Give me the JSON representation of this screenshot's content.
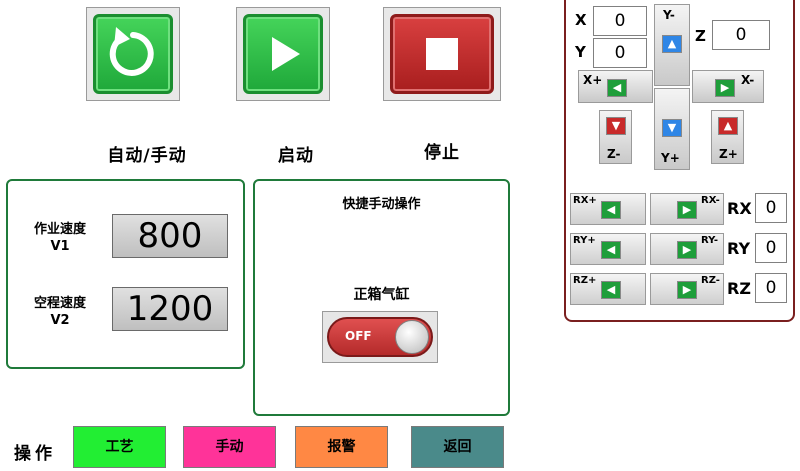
{
  "actions": {
    "auto_manual_label": "自动/手动",
    "start_label": "启动",
    "stop_label": "停止"
  },
  "speed_panel": {
    "work_speed_line1": "作业速度",
    "work_speed_line2": "V1",
    "work_speed_value": "800",
    "idle_speed_line1": "空程速度",
    "idle_speed_line2": "V2",
    "idle_speed_value": "1200"
  },
  "quick_panel": {
    "title": "快捷手动操作",
    "cylinder_label": "正箱气缸",
    "toggle_state": "OFF"
  },
  "jog": {
    "x_label": "X",
    "x_value": "0",
    "y_label": "Y",
    "y_value": "0",
    "z_label": "Z",
    "z_value": "0",
    "y_minus": "Y-",
    "y_plus": "Y+",
    "x_plus": "X+",
    "x_minus": "X-",
    "z_minus": "Z-",
    "z_plus": "Z+",
    "rx_plus": "RX+",
    "rx_minus": "RX-",
    "rx_label": "RX",
    "rx_value": "0",
    "ry_plus": "RY+",
    "ry_minus": "RY-",
    "ry_label": "RY",
    "ry_value": "0",
    "rz_plus": "RZ+",
    "rz_minus": "RZ-",
    "rz_label": "RZ",
    "rz_value": "0"
  },
  "bottom": {
    "operate_label": "操作",
    "process_label": "工艺",
    "manual_label": "手动",
    "alarm_label": "报警",
    "back_label": "返回"
  },
  "colors": {
    "process": "#22ee33",
    "manual": "#ff3399",
    "alarm": "#ff8844",
    "back": "#4a8a8a"
  }
}
